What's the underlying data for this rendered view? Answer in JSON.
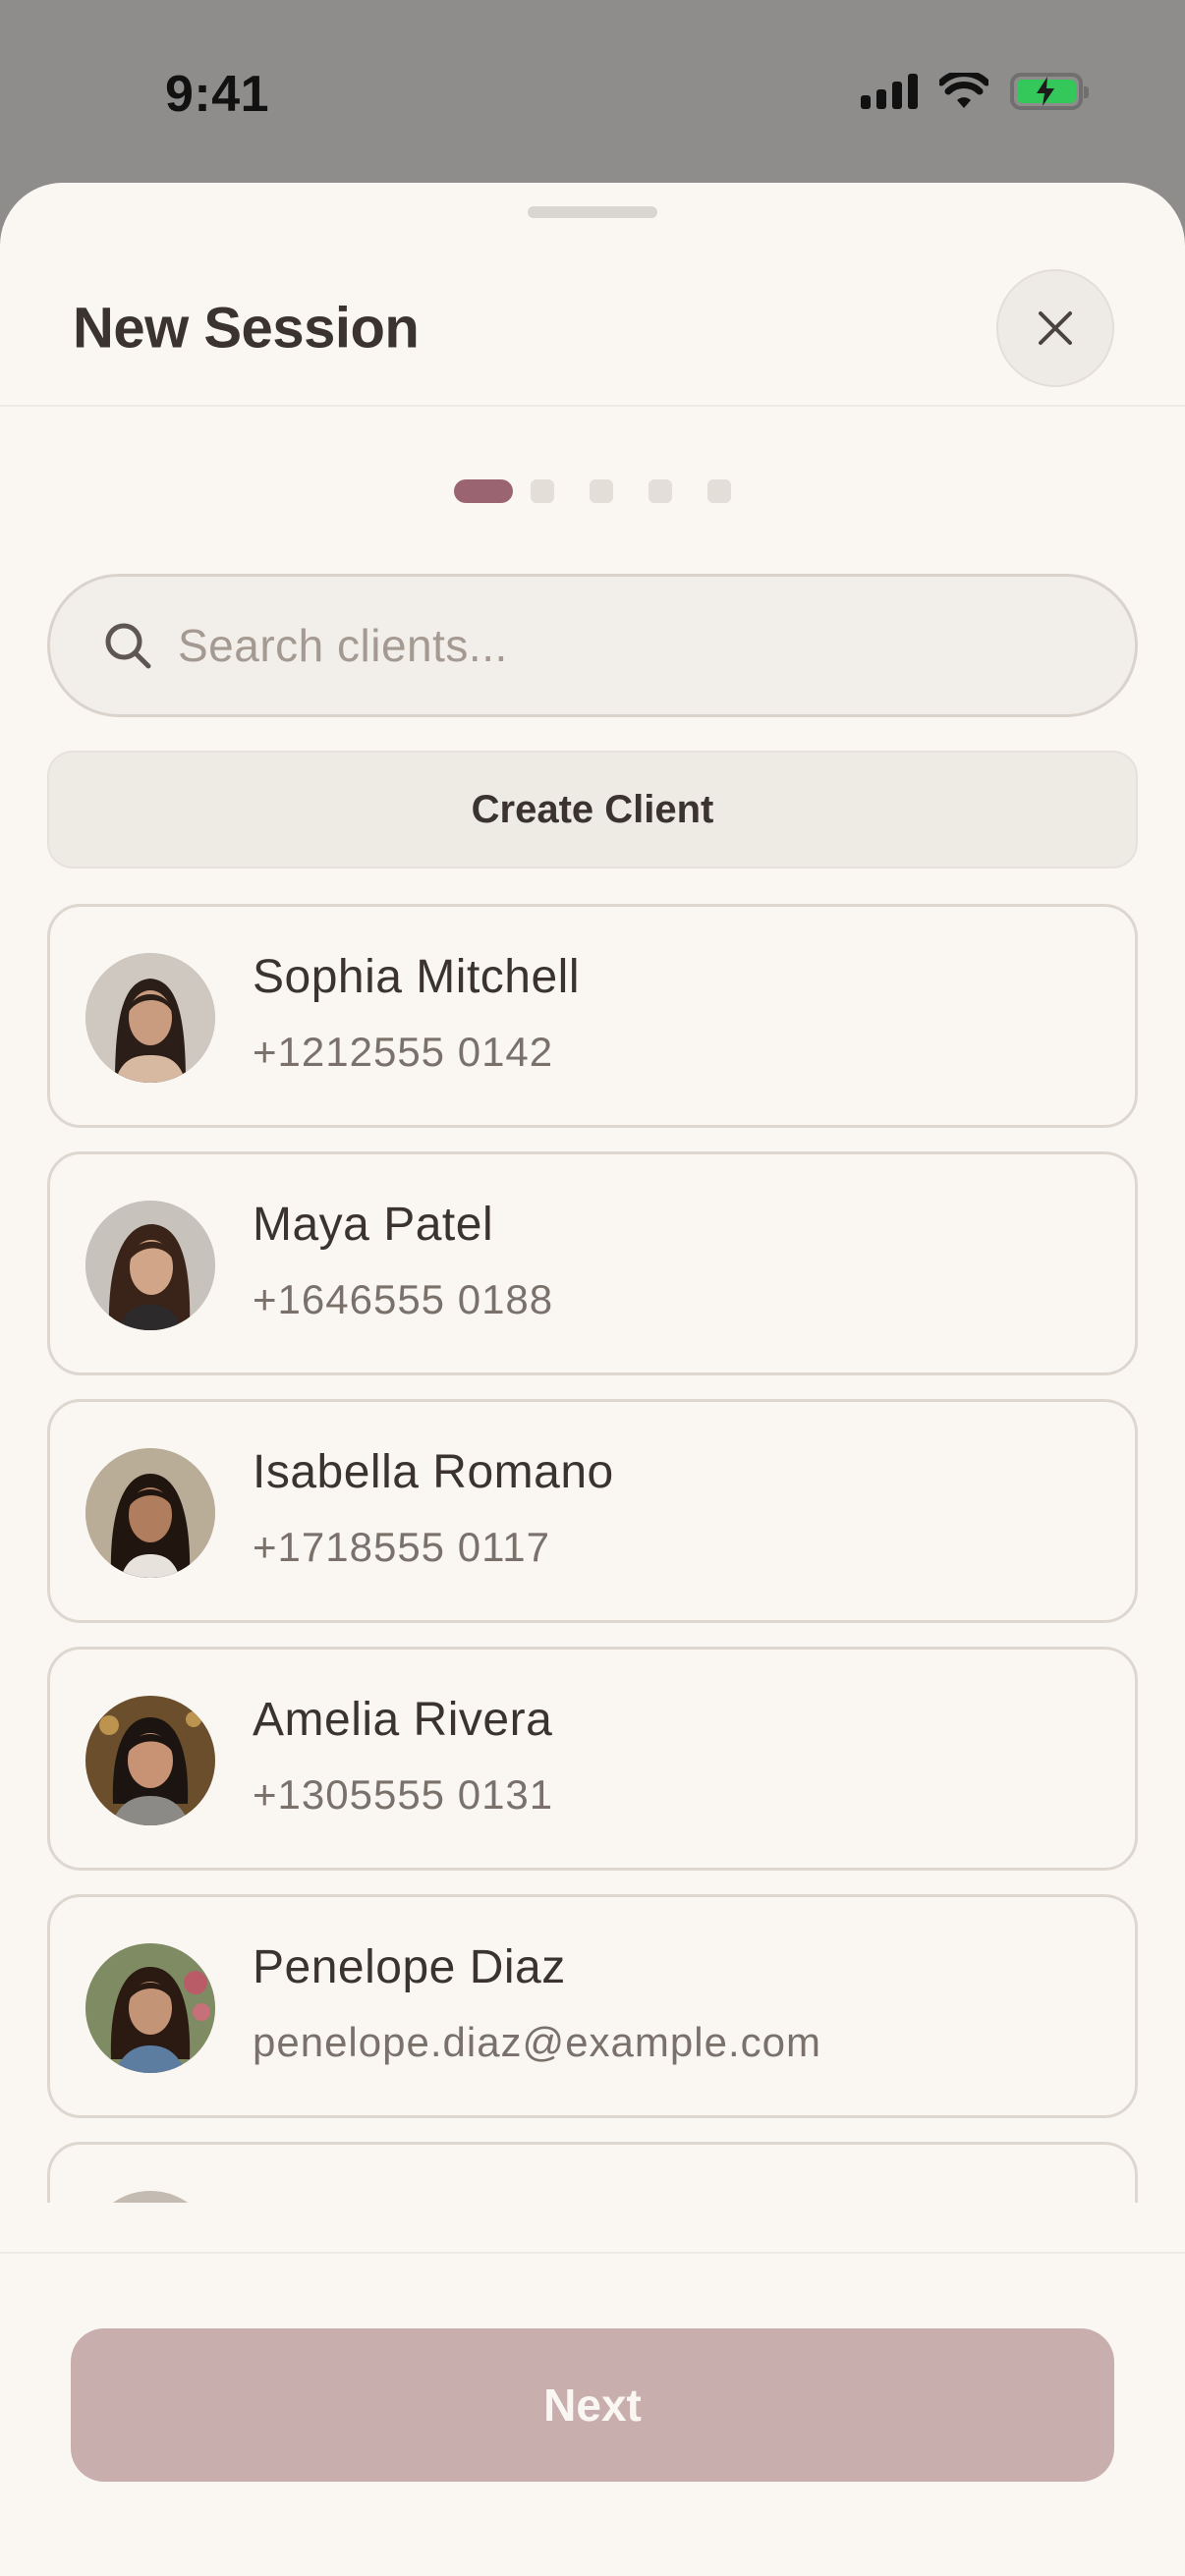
{
  "status_bar": {
    "time": "9:41"
  },
  "sheet": {
    "title": "New Session",
    "step_count": 5,
    "current_step": 1
  },
  "search": {
    "placeholder": "Search clients..."
  },
  "create_client_label": "Create Client",
  "clients": [
    {
      "name": "Sophia Mitchell",
      "contact": "+1212555 0142"
    },
    {
      "name": "Maya Patel",
      "contact": "+1646555 0188"
    },
    {
      "name": "Isabella Romano",
      "contact": "+1718555 0117"
    },
    {
      "name": "Amelia Rivera",
      "contact": "+1305555 0131"
    },
    {
      "name": "Penelope Diaz",
      "contact": "penelope.diaz@example.com"
    },
    {
      "name": "",
      "contact": ""
    }
  ],
  "footer": {
    "next_label": "Next"
  },
  "colors": {
    "accent": "#9a6470",
    "next_disabled": "#c9aeae",
    "background": "#faf7f3",
    "battery": "#34c759"
  }
}
